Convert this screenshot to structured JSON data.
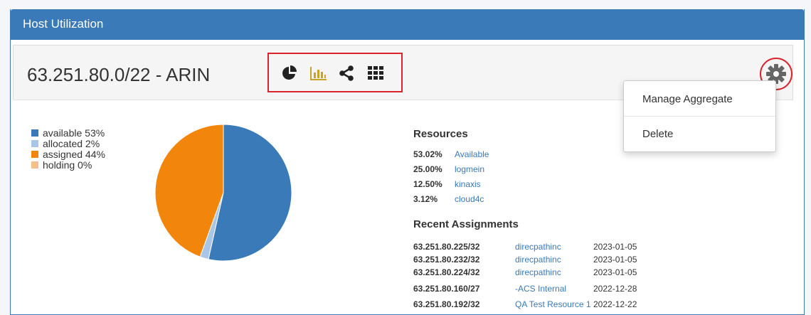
{
  "panel": {
    "title": "Host Utilization"
  },
  "block": {
    "title": "63.251.80.0/22 - ARIN",
    "toolbar_icons": [
      "pie-chart-icon",
      "bar-chart-icon",
      "share-icon",
      "grid-icon"
    ],
    "settings_icon": "gear-icon"
  },
  "dropdown": {
    "items": [
      {
        "label": "Manage Aggregate"
      },
      {
        "label": "Delete"
      }
    ]
  },
  "legend": {
    "items": [
      {
        "label": "available 53%",
        "color": "#3a7ab8"
      },
      {
        "label": "allocated 2%",
        "color": "#a9c6e6"
      },
      {
        "label": "assigned 44%",
        "color": "#f2850b"
      },
      {
        "label": "holding 0%",
        "color": "#f2c08a"
      }
    ]
  },
  "chart_data": {
    "type": "pie",
    "categories": [
      "available",
      "allocated",
      "assigned",
      "holding"
    ],
    "values": [
      53,
      2,
      44,
      0
    ],
    "colors": [
      "#3a7ab8",
      "#a9c6e6",
      "#f2850b",
      "#f2c08a"
    ]
  },
  "resources": {
    "title": "Resources",
    "rows": [
      {
        "pct": "53.02%",
        "name": "Available"
      },
      {
        "pct": "25.00%",
        "name": "logmein"
      },
      {
        "pct": "12.50%",
        "name": "kinaxis"
      },
      {
        "pct": "3.12%",
        "name": "cloud4c"
      }
    ]
  },
  "recent": {
    "title": "Recent Assignments",
    "rows": [
      {
        "cidr": "63.251.80.225/32",
        "name": "direcpathinc",
        "date": "2023-01-05"
      },
      {
        "cidr": "63.251.80.232/32",
        "name": "direcpathinc",
        "date": "2023-01-05"
      },
      {
        "cidr": "63.251.80.224/32",
        "name": "direcpathinc",
        "date": "2023-01-05"
      },
      {
        "cidr": "63.251.80.160/27",
        "name": "-ACS Internal",
        "date": "2022-12-28"
      },
      {
        "cidr": "63.251.80.192/32",
        "name": "QA Test Resource 1",
        "date": "2022-12-22"
      }
    ]
  }
}
